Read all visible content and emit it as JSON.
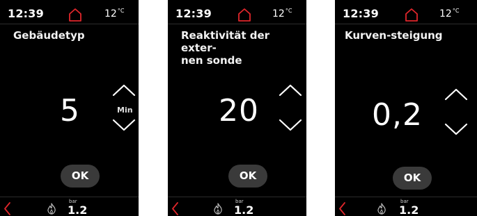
{
  "colors": {
    "screen_bg": "#000000",
    "text": "#ffffff",
    "accent_red": "#e0262b",
    "button_bg": "#3a3a3a",
    "divider": "#2c2c2c"
  },
  "screens": [
    {
      "status": {
        "time": "12:39",
        "temperature": "12",
        "temperature_unit": "°C",
        "home_icon": "home-icon"
      },
      "title": "Gebäudetyp",
      "value": "5",
      "unit": "Min",
      "arrows": {
        "up_icon": "chevron-up-icon",
        "down_icon": "chevron-down-icon"
      },
      "ok_label": "OK",
      "footer": {
        "back_icon": "chevron-left-icon",
        "flame_icon": "flame-icon",
        "pressure_unit": "bar",
        "pressure_value": "1.2"
      }
    },
    {
      "status": {
        "time": "12:39",
        "temperature": "12",
        "temperature_unit": "°C",
        "home_icon": "home-icon"
      },
      "title": "Reaktivität der exter-\nnen sonde",
      "value": "20",
      "unit": "",
      "arrows": {
        "up_icon": "chevron-up-icon",
        "down_icon": "chevron-down-icon"
      },
      "ok_label": "OK",
      "footer": {
        "back_icon": "chevron-left-icon",
        "flame_icon": "flame-icon",
        "pressure_unit": "bar",
        "pressure_value": "1.2"
      }
    },
    {
      "status": {
        "time": "12:39",
        "temperature": "12",
        "temperature_unit": "°C",
        "home_icon": "home-icon"
      },
      "title": "Kurven-steigung",
      "value": "0,2",
      "unit": "",
      "arrows": {
        "up_icon": "chevron-up-icon",
        "down_icon": "chevron-down-icon"
      },
      "ok_label": "OK",
      "footer": {
        "back_icon": "chevron-left-icon",
        "flame_icon": "flame-icon",
        "pressure_unit": "bar",
        "pressure_value": "1.2"
      }
    }
  ]
}
